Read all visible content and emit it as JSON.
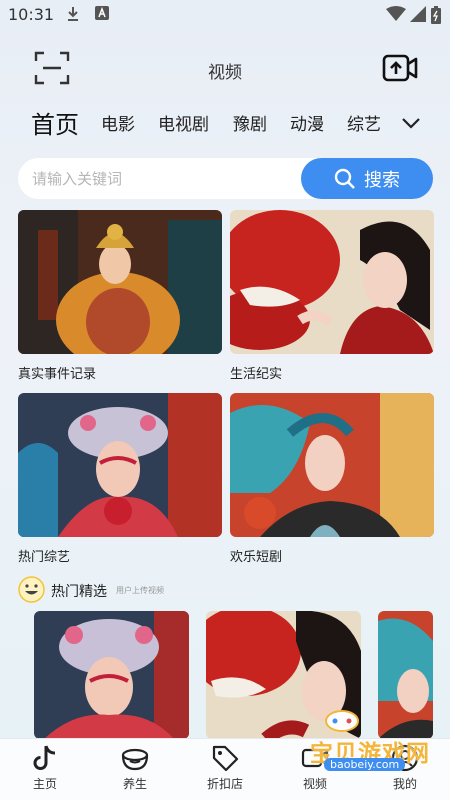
{
  "status_bar": {
    "time": "10:31"
  },
  "header": {
    "title": "视频"
  },
  "tabs": [
    {
      "label": "首页",
      "active": true
    },
    {
      "label": "电影"
    },
    {
      "label": "电视剧"
    },
    {
      "label": "豫剧"
    },
    {
      "label": "动漫"
    },
    {
      "label": "综艺"
    }
  ],
  "search": {
    "placeholder": "请输入关键词",
    "button_label": "搜索"
  },
  "categories": [
    {
      "label": "真实事件记录",
      "image": "emperor-costume-drama-photo"
    },
    {
      "label": "生活纪实",
      "image": "opera-actress-red-robe-photo"
    },
    {
      "label": "热门综艺",
      "image": "peking-opera-headdress-photo"
    },
    {
      "label": "欢乐短剧",
      "image": "opera-performer-profile-photo"
    }
  ],
  "section": {
    "title": "热门精选",
    "subtitle": "用户上传视频"
  },
  "feed": [
    {
      "image": "peking-opera-headdress-photo"
    },
    {
      "image": "opera-actress-red-robe-photo"
    },
    {
      "image": "opera-performer-profile-photo"
    }
  ],
  "nav": [
    {
      "label": "主页",
      "icon": "tiktok-note-icon"
    },
    {
      "label": "养生",
      "icon": "bowl-icon"
    },
    {
      "label": "折扣店",
      "icon": "tag-icon"
    },
    {
      "label": "视频",
      "icon": "video-icon"
    },
    {
      "label": "我的",
      "icon": "user-icon"
    }
  ],
  "watermark": {
    "text": "宝贝游戏网",
    "url": "baobeiy.com"
  },
  "colors": {
    "accent": "#3d8ef0",
    "background": "#e8eef6"
  }
}
